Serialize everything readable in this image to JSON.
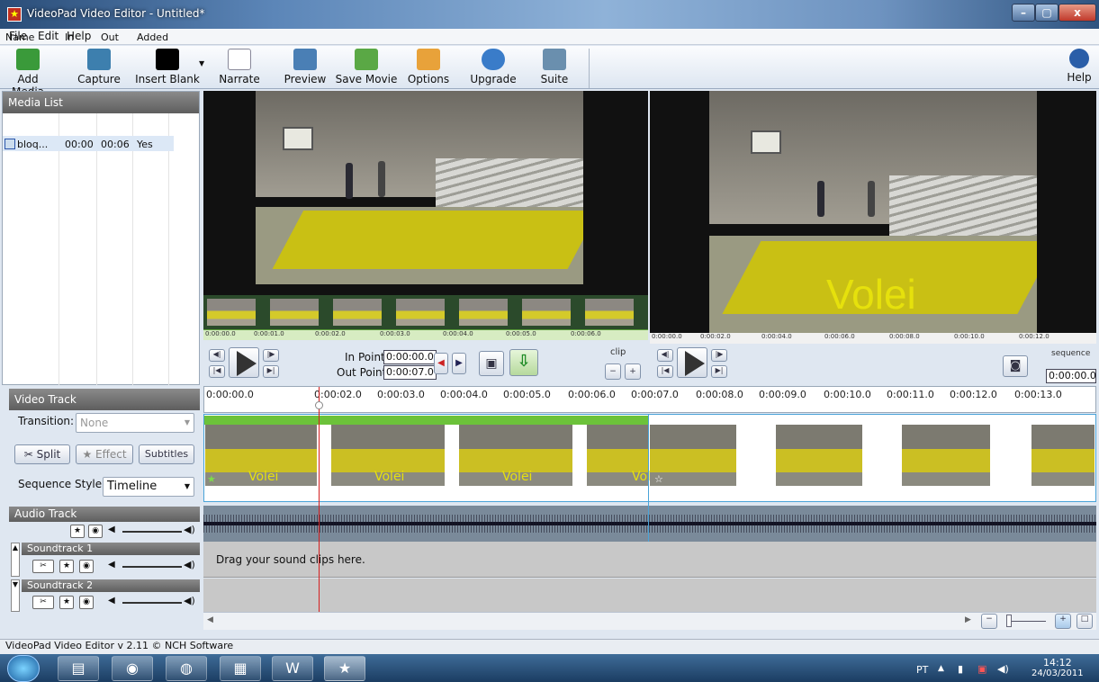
{
  "window": {
    "title": "VideoPad Video Editor - Untitled*",
    "minimize": "–",
    "maximize": "▢",
    "close": "x"
  },
  "menu": [
    "File",
    "Edit",
    "Help"
  ],
  "toolbar": {
    "items": [
      "Add Media",
      "Capture",
      "Insert Blank",
      "Narrate",
      "Preview",
      "Save Movie",
      "Options",
      "Upgrade",
      "Suite"
    ],
    "help": "Help"
  },
  "media_list": {
    "title": "Media List",
    "columns": [
      "Name",
      "In",
      "Out",
      "Added"
    ],
    "rows": [
      {
        "name": "bloq...",
        "in": "00:00",
        "out": "00:06",
        "added": "Yes"
      }
    ]
  },
  "clip_preview": {
    "ruler": [
      "0:00:00.0",
      "0:00:01.0",
      "0:00:02.0",
      "0:00:03.0",
      "0:00:04.0",
      "0:00:05.0",
      "0:00:06.0"
    ],
    "in_label": "In Point",
    "in_value": "0:00:00.0",
    "out_label": "Out Point",
    "out_value": "0:00:07.0",
    "tab": "clip"
  },
  "sequence_preview": {
    "overlay_text": "Volei",
    "ruler": [
      "0:00:00.0",
      "0:00:02.0",
      "0:00:04.0",
      "0:00:06.0",
      "0:00:08.0",
      "0:00:10.0",
      "0:00:12.0"
    ],
    "tab": "sequence",
    "time": "0:00:00.0"
  },
  "video_track": {
    "title": "Video Track",
    "transition_label": "Transition:",
    "transition_value": "None",
    "split": "Split",
    "effect": "Effect",
    "subtitles": "Subtitles",
    "sequence_style_label": "Sequence Style:",
    "sequence_style_value": "Timeline"
  },
  "timeline_ruler": [
    "0:00:00.0",
    "0:00:02.0",
    "0:00:03.0",
    "0:00:04.0",
    "0:00:05.0",
    "0:00:06.0",
    "0:00:07.0",
    "0:00:08.0",
    "0:00:09.0",
    "0:00:10.0",
    "0:00:11.0",
    "0:00:12.0",
    "0:00:13.0"
  ],
  "clip_text": [
    "Volei",
    "Volei",
    "Volei",
    "Vol"
  ],
  "audio_track": {
    "title": "Audio Track",
    "soundtrack1": "Soundtrack 1",
    "soundtrack2": "Soundtrack 2",
    "drop_hint": "Drag your sound clips here."
  },
  "status": "VideoPad Video Editor v 2.11 © NCH Software",
  "tray": {
    "lang": "PT",
    "time": "14:12",
    "date": "24/03/2011"
  },
  "colors": {
    "clip_green": "#6cc23a",
    "volei_yellow": "#e6e10c",
    "playhead": "#d42020"
  }
}
